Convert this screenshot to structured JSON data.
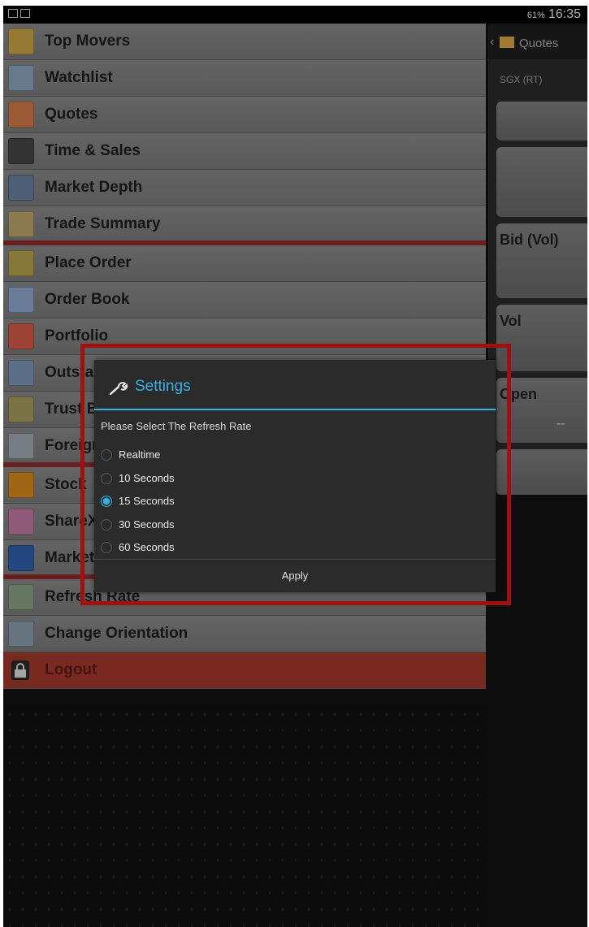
{
  "status_bar": {
    "battery": "61%",
    "time": "16:35"
  },
  "menu": {
    "items": [
      {
        "label": "Top Movers",
        "icon": "top-movers-icon"
      },
      {
        "label": "Watchlist",
        "icon": "watchlist-icon"
      },
      {
        "label": "Quotes",
        "icon": "quotes-icon"
      },
      {
        "label": "Time & Sales",
        "icon": "time-sales-icon"
      },
      {
        "label": "Market Depth",
        "icon": "market-depth-icon"
      },
      {
        "label": "Trade Summary",
        "icon": "trade-summary-icon"
      },
      {
        "label": "Place Order",
        "icon": "place-order-icon"
      },
      {
        "label": "Order Book",
        "icon": "order-book-icon"
      },
      {
        "label": "Portfolio",
        "icon": "portfolio-icon"
      },
      {
        "label": "Outstanding",
        "icon": "outstanding-icon"
      },
      {
        "label": "Trust Balance",
        "icon": "trust-icon"
      },
      {
        "label": "Foreign",
        "icon": "foreign-icon"
      },
      {
        "label": "Stock",
        "icon": "stock-icon"
      },
      {
        "label": "ShareX",
        "icon": "sharex-icon"
      },
      {
        "label": "Market",
        "icon": "market-icon"
      },
      {
        "label": "Refresh Rate",
        "icon": "refresh-icon"
      },
      {
        "label": "Change Orientation",
        "icon": "orientation-icon"
      },
      {
        "label": "Logout",
        "icon": "lock-icon"
      }
    ]
  },
  "right_panel": {
    "title": "Quotes",
    "exchange": "SGX (RT)",
    "bid_label": "Bid (Vol)",
    "vol_label": "Vol",
    "open_label": "Open",
    "open_value": "--"
  },
  "dialog": {
    "title": "Settings",
    "prompt": "Please Select The Refresh Rate",
    "options": [
      "Realtime",
      "10 Seconds",
      "15 Seconds",
      "30 Seconds",
      "60 Seconds"
    ],
    "selected": "15 Seconds",
    "apply_label": "Apply"
  },
  "colors": {
    "accent": "#39b0e4",
    "highlight": "#a01010",
    "logout": "#a0392c"
  }
}
